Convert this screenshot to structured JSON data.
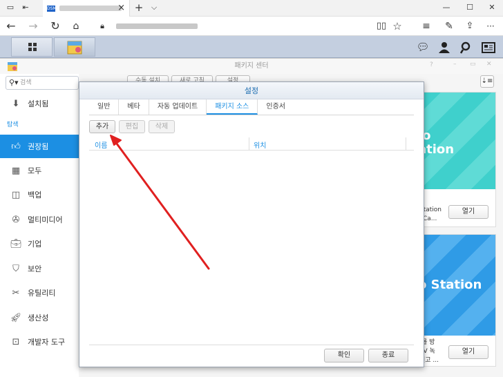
{
  "browser": {
    "tab_close": "×",
    "new_tab": "+",
    "tab_list": "⌵",
    "win_min": "—",
    "win_max": "☐",
    "win_close": "✕",
    "more": "···"
  },
  "package_center": {
    "title": "패키지 센터",
    "search_placeholder": "검색",
    "installed": "설치됨",
    "explore_label": "탐색",
    "nav": [
      {
        "label": "권장됨",
        "icon": "thumbs-up-icon"
      },
      {
        "label": "모두",
        "icon": "grid-icon"
      },
      {
        "label": "백업",
        "icon": "backup-icon"
      },
      {
        "label": "멀티미디어",
        "icon": "film-reel-icon"
      },
      {
        "label": "기업",
        "icon": "briefcase-icon"
      },
      {
        "label": "보안",
        "icon": "shield-icon"
      },
      {
        "label": "유틸리티",
        "icon": "tools-icon"
      },
      {
        "label": "생산성",
        "icon": "rocket-icon"
      },
      {
        "label": "개발자 도구",
        "icon": "terminal-icon"
      }
    ],
    "toolbar": {
      "manual_install": "수동 설치",
      "refresh": "새로 고침",
      "settings": "설정"
    },
    "cards": [
      {
        "banner_line1": "io",
        "banner_line2": "ation",
        "desc1": "Station",
        "desc2": "TCa...",
        "open": "열기"
      },
      {
        "banner_line1": "o Station",
        "desc1": "|를 방",
        "desc2": "TV 녹",
        "desc3": "년고 ...",
        "open": "열기"
      }
    ]
  },
  "dialog": {
    "title": "설정",
    "tabs": [
      "일반",
      "베타",
      "자동 업데이트",
      "패키지 소스",
      "인증서"
    ],
    "active_tab": "패키지 소스",
    "add": "추가",
    "edit": "편집",
    "delete": "삭제",
    "col_name": "이름",
    "col_location": "위치",
    "ok": "확인",
    "close": "종료"
  },
  "colors": {
    "accent": "#1c8fe3",
    "annotation_arrow": "#e02020"
  }
}
